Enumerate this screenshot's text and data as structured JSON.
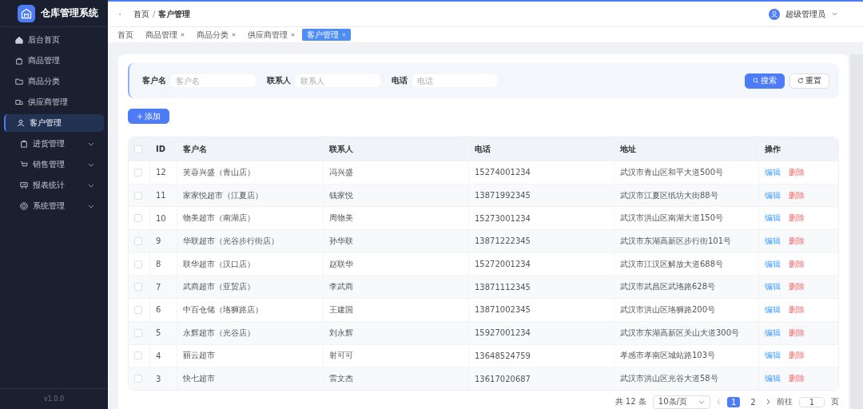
{
  "sidebar": {
    "title": "仓库管理系统",
    "version": "v1.0.0",
    "items": [
      {
        "label": "后台首页",
        "kind": "link",
        "selected": false
      },
      {
        "label": "商品管理",
        "kind": "link",
        "selected": false
      },
      {
        "label": "商品分类",
        "kind": "link",
        "selected": false
      },
      {
        "label": "供应商管理",
        "kind": "link",
        "selected": false
      },
      {
        "label": "客户管理",
        "kind": "link",
        "selected": true
      },
      {
        "label": "进货管理",
        "kind": "submenu",
        "selected": false
      },
      {
        "label": "销售管理",
        "kind": "submenu",
        "selected": false
      },
      {
        "label": "报表统计",
        "kind": "submenu",
        "selected": false
      },
      {
        "label": "系统管理",
        "kind": "submenu",
        "selected": false
      }
    ]
  },
  "header": {
    "breadcrumb": [
      "首页",
      "客户管理"
    ],
    "breadcrumb_separator": "/",
    "user": "超级管理员"
  },
  "tabs": [
    {
      "label": "首页",
      "closable": false,
      "selected": false
    },
    {
      "label": "商品管理",
      "closable": true,
      "selected": false
    },
    {
      "label": "商品分类",
      "closable": true,
      "selected": false
    },
    {
      "label": "供应商管理",
      "closable": true,
      "selected": false
    },
    {
      "label": "客户管理",
      "closable": true,
      "selected": true
    }
  ],
  "search": {
    "fields": [
      {
        "label": "客户名",
        "placeholder": "客户名"
      },
      {
        "label": "联系人",
        "placeholder": "联系人"
      },
      {
        "label": "电话",
        "placeholder": "电话"
      }
    ],
    "search_button": "搜索",
    "reset_button": "重置"
  },
  "add_button": "添加",
  "table": {
    "select_all_checked": false,
    "columns": [
      "ID",
      "客户名",
      "联系人",
      "电话",
      "地址",
      "操作"
    ],
    "rows": [
      {
        "checked": false,
        "cells": [
          "12",
          "芙蓉兴盛（青山店）",
          "冯兴盛",
          "15274001234",
          "武汉市青山区和平大道500号"
        ],
        "edit": "编辑",
        "delete": "删除"
      },
      {
        "checked": false,
        "cells": [
          "11",
          "家家悦超市（江夏店）",
          "钱家悦",
          "13871992345",
          "武汉市江夏区纸坊大街88号"
        ],
        "edit": "编辑",
        "delete": "删除"
      },
      {
        "checked": false,
        "cells": [
          "10",
          "物美超市（南湖店）",
          "周物美",
          "15273001234",
          "武汉市洪山区南湖大道150号"
        ],
        "edit": "编辑",
        "delete": "删除"
      },
      {
        "checked": false,
        "cells": [
          "9",
          "华联超市（光谷步行街店）",
          "孙华联",
          "13871222345",
          "武汉市东湖高新区步行街101号"
        ],
        "edit": "编辑",
        "delete": "删除"
      },
      {
        "checked": false,
        "cells": [
          "8",
          "联华超市（汉口店）",
          "赵联华",
          "15272001234",
          "武汉市江汉区解放大道688号"
        ],
        "edit": "编辑",
        "delete": "删除"
      },
      {
        "checked": false,
        "cells": [
          "7",
          "武商超市（亚贸店）",
          "李武商",
          "13871112345",
          "武汉市武昌区武珞路628号"
        ],
        "edit": "编辑",
        "delete": "删除"
      },
      {
        "checked": false,
        "cells": [
          "6",
          "中百仓储（珞狮路店）",
          "王建国",
          "13871002345",
          "武汉市洪山区珞狮路200号"
        ],
        "edit": "编辑",
        "delete": "删除"
      },
      {
        "checked": false,
        "cells": [
          "5",
          "永辉超市（光谷店）",
          "刘永辉",
          "15927001234",
          "武汉市东湖高新区关山大道300号"
        ],
        "edit": "编辑",
        "delete": "删除"
      },
      {
        "checked": false,
        "cells": [
          "4",
          "丽云超市",
          "射可可",
          "13648524759",
          "孝感市孝南区城站路103号"
        ],
        "edit": "编辑",
        "delete": "删除"
      },
      {
        "checked": false,
        "cells": [
          "3",
          "快七超市",
          "雷文杰",
          "13617020687",
          "武汉市洪山区光谷大道58号"
        ],
        "edit": "编辑",
        "delete": "删除"
      }
    ]
  },
  "pagination": {
    "total": "共 12 条",
    "page_size": "10条/页",
    "pages": [
      {
        "label": "1",
        "selected": true
      },
      {
        "label": "2",
        "selected": false
      }
    ],
    "goto_label": "前往",
    "goto_value": "1",
    "page_suffix": "页"
  }
}
